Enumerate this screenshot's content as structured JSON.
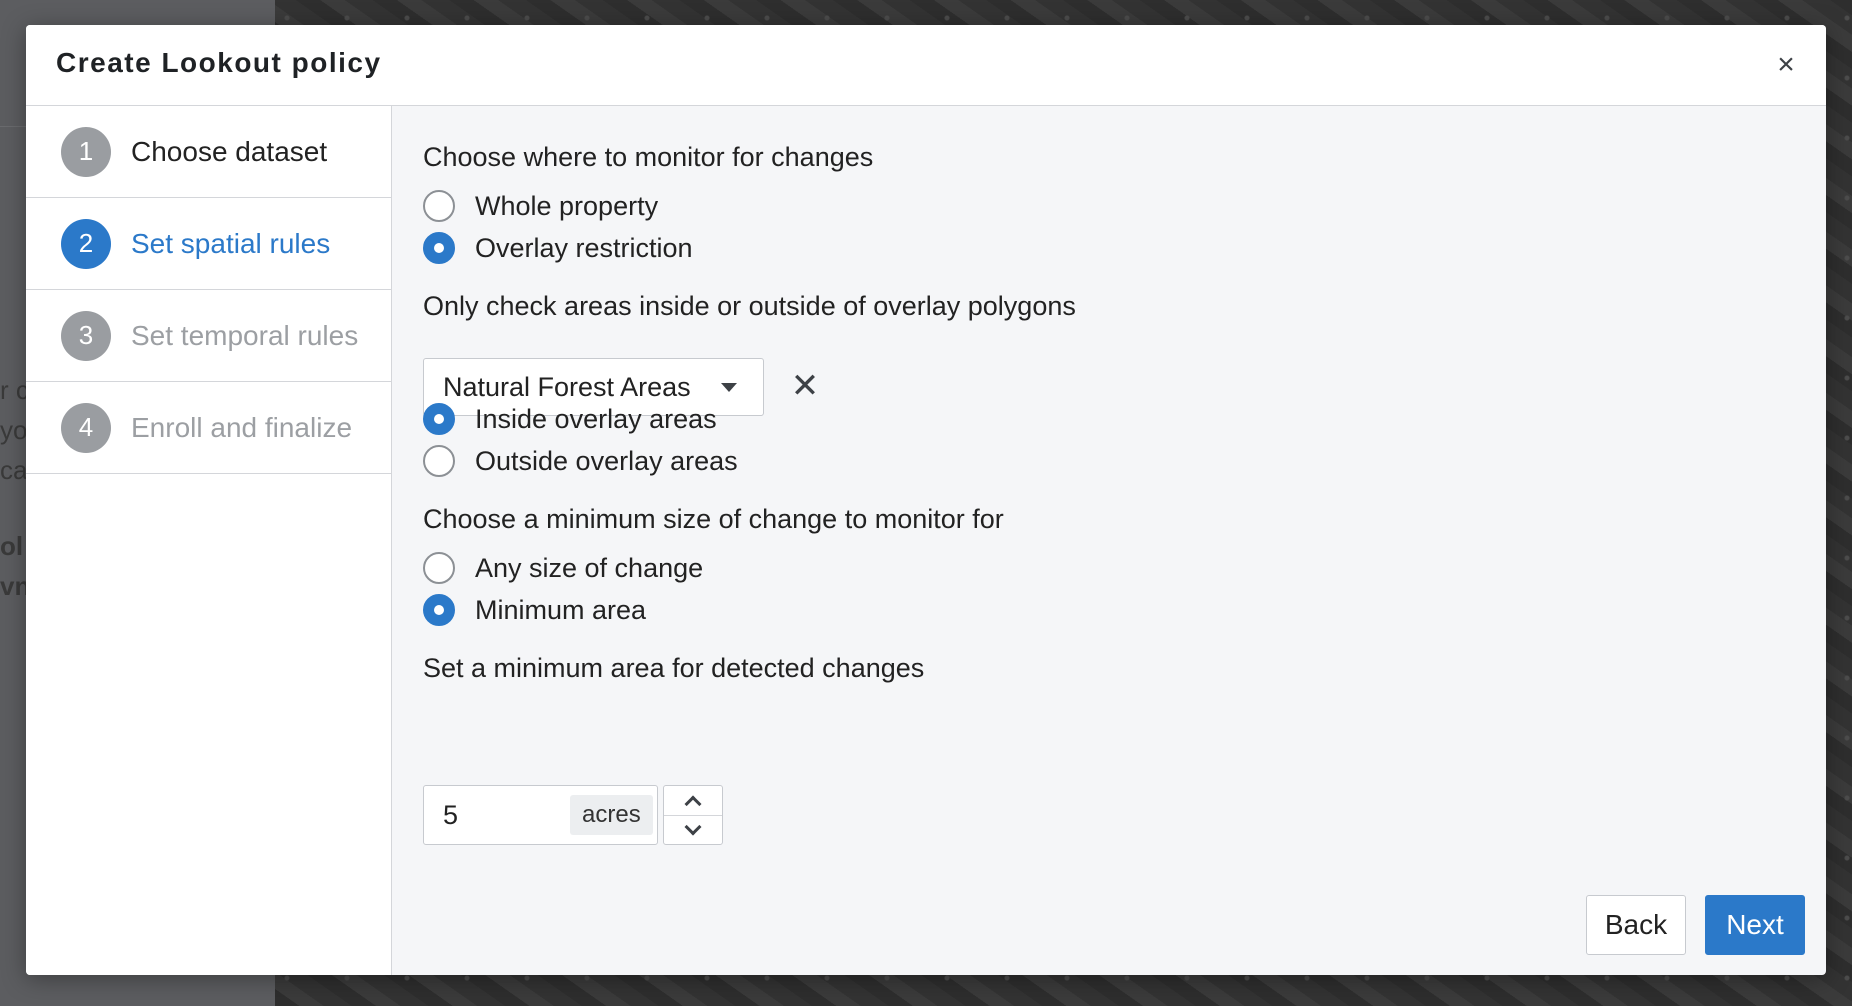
{
  "backdrop": {
    "fragments": [
      "r c",
      "yo",
      "ca",
      "ol",
      "vn"
    ]
  },
  "modal": {
    "title": "Create Lookout policy",
    "close_label": "×"
  },
  "steps": [
    {
      "number": "1",
      "label": "Choose dataset",
      "state": "complete"
    },
    {
      "number": "2",
      "label": "Set spatial rules",
      "state": "active"
    },
    {
      "number": "3",
      "label": "Set temporal rules",
      "state": "disabled"
    },
    {
      "number": "4",
      "label": "Enroll and finalize",
      "state": "disabled"
    }
  ],
  "monitor_where": {
    "label": "Choose where to monitor for changes",
    "options": [
      {
        "label": "Whole property",
        "checked": false
      },
      {
        "label": "Overlay restriction",
        "checked": true
      }
    ]
  },
  "overlay": {
    "label": "Only check areas inside or outside of overlay polygons",
    "selected": "Natural Forest Areas",
    "clear_label": "✕",
    "options": [
      {
        "label": "Inside overlay areas",
        "checked": true
      },
      {
        "label": "Outside overlay areas",
        "checked": false
      }
    ]
  },
  "min_size": {
    "label": "Choose a minimum size of change to monitor for",
    "options": [
      {
        "label": "Any size of change",
        "checked": false
      },
      {
        "label": "Minimum area",
        "checked": true
      }
    ]
  },
  "min_area": {
    "label": "Set a minimum area for detected changes",
    "value": "5",
    "unit": "acres"
  },
  "footer": {
    "back_label": "Back",
    "next_label": "Next"
  },
  "colors": {
    "accent": "#2b79c9",
    "step_inactive": "#9a9da1"
  },
  "icons": {
    "close": "close-icon",
    "clear": "clear-icon",
    "dropdown": "chevron-down-icon",
    "increment": "chevron-up-icon",
    "decrement": "chevron-down-icon"
  }
}
